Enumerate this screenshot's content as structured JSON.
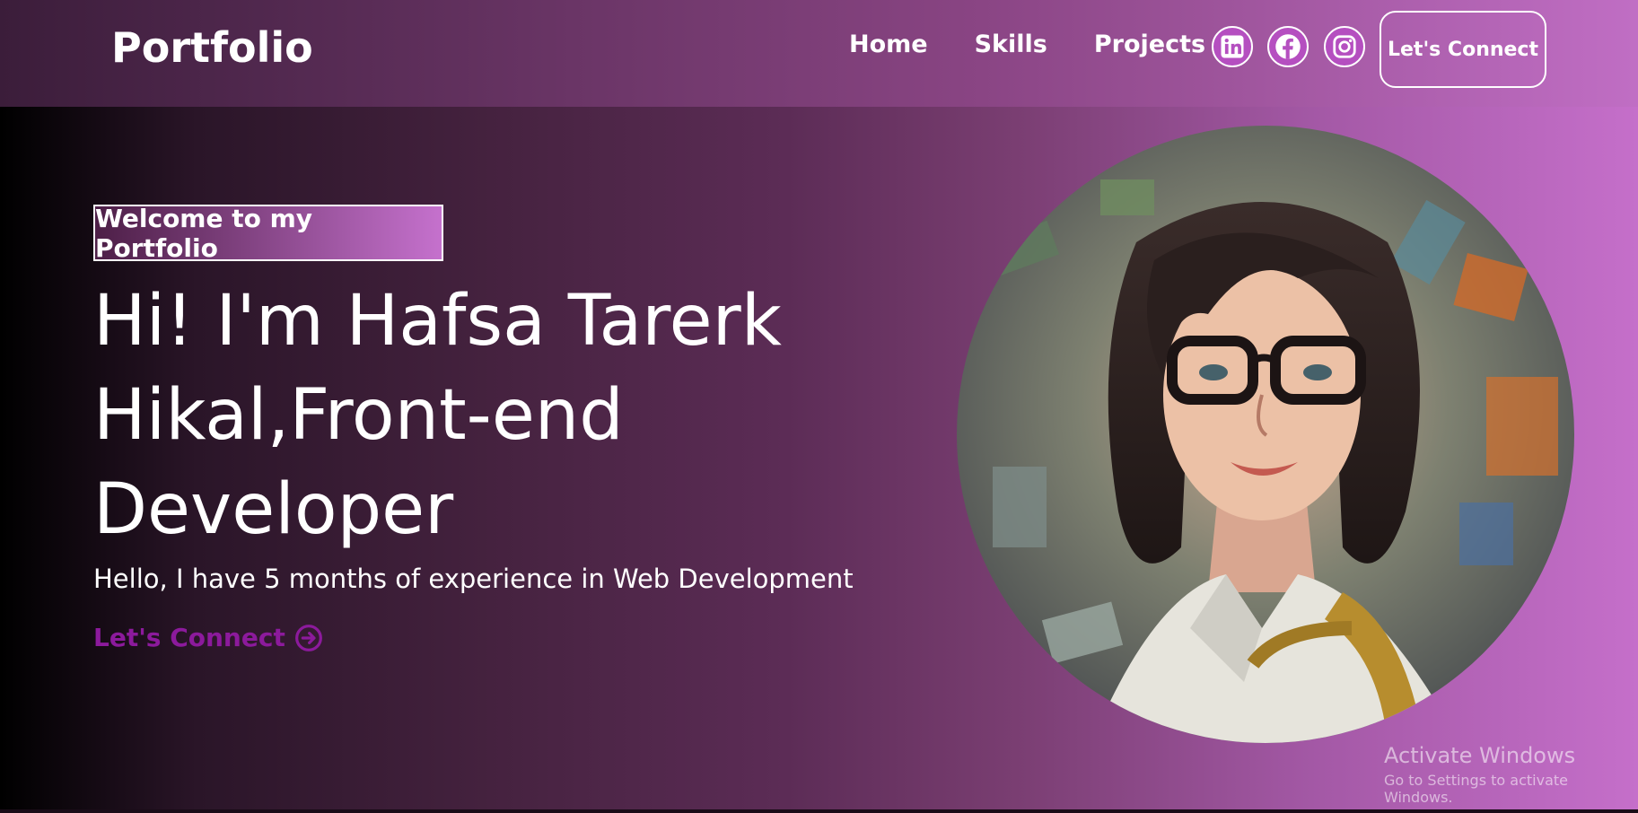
{
  "navbar": {
    "brand": "Portfolio",
    "links": [
      "Home",
      "Skills",
      "Projects"
    ],
    "social_icons": [
      "linkedin-icon",
      "facebook-icon",
      "instagram-icon"
    ],
    "connect_label": "Let's Connect"
  },
  "hero": {
    "tagline": "Welcome to my Portfolio",
    "headline": "Hi! I'm Hafsa Tarerk Hikal,Front-end Developer",
    "subtext": "Hello, I have 5 months of experience in Web Development",
    "cta_label": "Let's Connect",
    "cta_icon": "arrow-right-circle-icon",
    "image": "portrait-illustration"
  },
  "watermark": {
    "title": "Activate Windows",
    "subtitle": "Go to Settings to activate Windows."
  },
  "colors": {
    "accent": "#8c1a9c",
    "nav_gradient_start": "#3b1d3a",
    "nav_gradient_end": "#c06ec4"
  }
}
